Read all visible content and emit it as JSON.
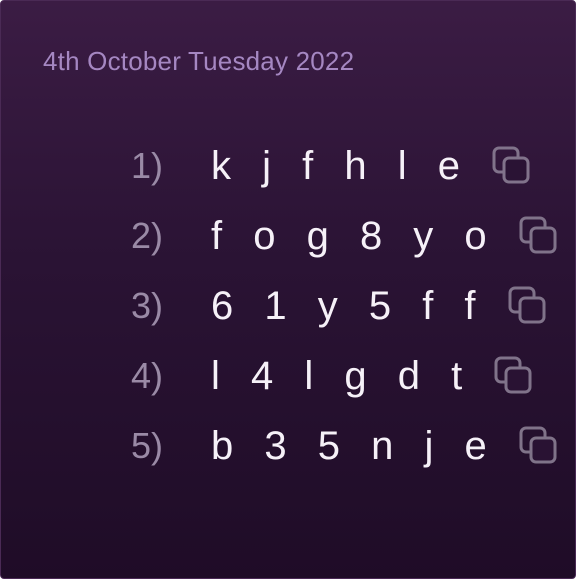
{
  "date": "4th October Tuesday 2022",
  "codes": [
    {
      "num": "1)",
      "code": "k j f h l e"
    },
    {
      "num": "2)",
      "code": "f o g 8 y o"
    },
    {
      "num": "3)",
      "code": "6 1 y 5 f f"
    },
    {
      "num": "4)",
      "code": "l 4 l g d t"
    },
    {
      "num": "5)",
      "code": "b 3 5 n j e"
    }
  ],
  "colors": {
    "background_top": "#3b1c44",
    "background_bottom": "#1f0c27",
    "date_text": "#a587c2",
    "number_text": "#9a8aa6",
    "code_text": "#f6f1f8",
    "copy_icon": "#8a7e94"
  },
  "icons": {
    "copy": "copy-icon"
  }
}
